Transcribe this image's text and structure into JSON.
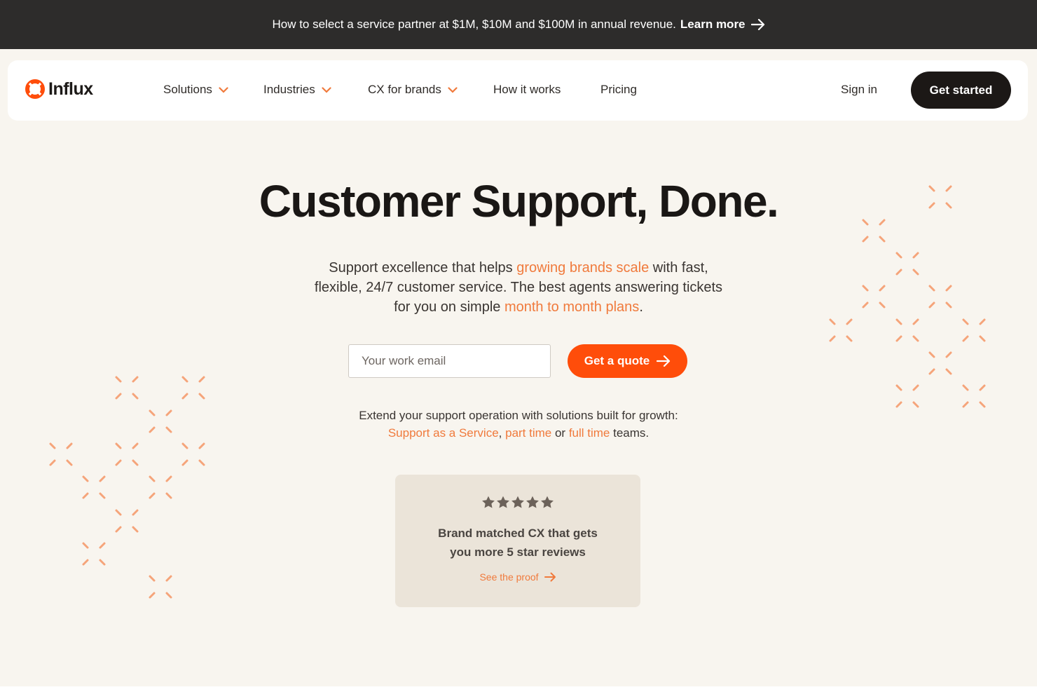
{
  "announcement": {
    "message": "How to select a service partner at $1M, $10M and $100M in annual revenue.",
    "link_label": "Learn more",
    "icon": "arrow-right-icon"
  },
  "nav": {
    "logo_text": "Influx",
    "logo_icon": "lifebuoy-icon",
    "items": [
      {
        "label": "Solutions",
        "has_dropdown": true
      },
      {
        "label": "Industries",
        "has_dropdown": true
      },
      {
        "label": "CX for brands",
        "has_dropdown": true
      },
      {
        "label": "How it works",
        "has_dropdown": false
      },
      {
        "label": "Pricing",
        "has_dropdown": false
      }
    ],
    "sign_in": "Sign in",
    "cta": "Get started"
  },
  "hero": {
    "title": "Customer Support, Done.",
    "subtitle_parts": [
      "Support excellence that helps ",
      "growing brands scale",
      " with fast, flexible, 24/7 customer service. The best agents answering tickets for you on simple ",
      "month to month plans",
      "."
    ],
    "email_placeholder": "Your work email",
    "quote_button": "Get a quote"
  },
  "extend": {
    "text": "Extend your support operation with solutions built for growth:",
    "links": [
      "Support as a Service",
      "part time",
      "full time"
    ],
    "sep1": ", ",
    "sep2": " or ",
    "suffix": " teams."
  },
  "proof_card": {
    "rating": 5,
    "line1": "Brand matched CX that gets",
    "line2": "you more 5 star reviews",
    "link": "See the proof"
  },
  "colors": {
    "accent": "#f07a3c",
    "cta_orange": "#ff4d0a",
    "dark": "#1c1816",
    "banner": "#2d2c2b",
    "background": "#f8f5ef",
    "card": "#ebe4d9"
  }
}
